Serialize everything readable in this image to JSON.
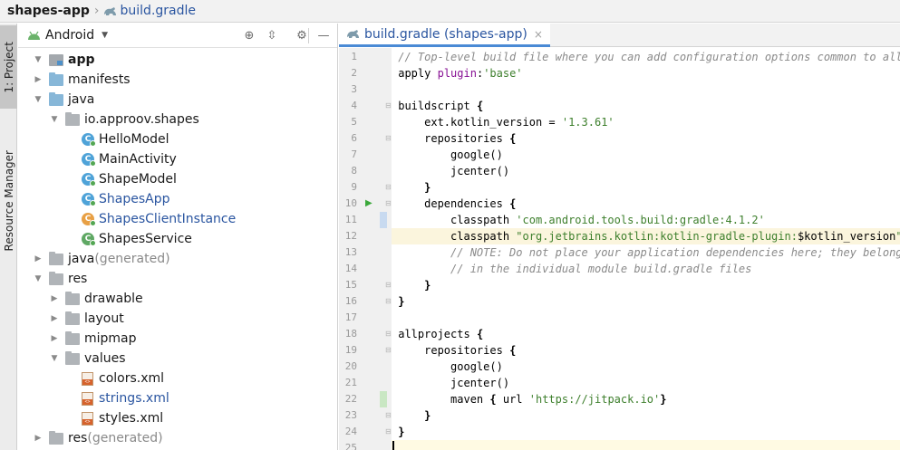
{
  "breadcrumb": {
    "project": "shapes-app",
    "file": "build.gradle"
  },
  "stripe": {
    "project_tab": "1: Project",
    "resource_tab": "Resource Manager"
  },
  "project_panel": {
    "view_label": "Android",
    "tree": [
      {
        "label": "app",
        "bold": true
      },
      {
        "label": "manifests"
      },
      {
        "label": "java"
      },
      {
        "label": "io.approov.shapes"
      },
      {
        "label": "HelloModel"
      },
      {
        "label": "MainActivity"
      },
      {
        "label": "ShapeModel"
      },
      {
        "label": "ShapesApp"
      },
      {
        "label": "ShapesClientInstance"
      },
      {
        "label": "ShapesService"
      },
      {
        "label": "java",
        "suffix": "(generated)"
      },
      {
        "label": "res"
      },
      {
        "label": "drawable"
      },
      {
        "label": "layout"
      },
      {
        "label": "mipmap"
      },
      {
        "label": "values"
      },
      {
        "label": "colors.xml"
      },
      {
        "label": "strings.xml"
      },
      {
        "label": "styles.xml"
      },
      {
        "label": "res",
        "suffix": "(generated)"
      }
    ]
  },
  "editor": {
    "tab_label": "build.gradle (shapes-app)",
    "close_glyph": "×",
    "lines": [
      {
        "n": "1",
        "parts": [
          [
            "c",
            "// Top-level build file where you can add configuration options common to all sub-projects/modules."
          ]
        ]
      },
      {
        "n": "2",
        "parts": [
          [
            "t",
            "apply "
          ],
          [
            "p",
            "plugin"
          ],
          [
            "t",
            ":"
          ],
          [
            "s",
            "'base'"
          ]
        ]
      },
      {
        "n": "3",
        "parts": []
      },
      {
        "n": "4",
        "parts": [
          [
            "t",
            "buildscript "
          ],
          [
            "k",
            "{"
          ]
        ]
      },
      {
        "n": "5",
        "parts": [
          [
            "t",
            "    ext.kotlin_version = "
          ],
          [
            "s",
            "'1.3.61'"
          ]
        ]
      },
      {
        "n": "6",
        "parts": [
          [
            "t",
            "    repositories "
          ],
          [
            "k",
            "{"
          ]
        ]
      },
      {
        "n": "7",
        "parts": [
          [
            "t",
            "        google()"
          ]
        ]
      },
      {
        "n": "8",
        "parts": [
          [
            "t",
            "        jcenter()"
          ]
        ]
      },
      {
        "n": "9",
        "parts": [
          [
            "t",
            "    "
          ],
          [
            "k",
            "}"
          ]
        ]
      },
      {
        "n": "10",
        "parts": [
          [
            "t",
            "    dependencies "
          ],
          [
            "k",
            "{"
          ]
        ]
      },
      {
        "n": "11",
        "parts": [
          [
            "t",
            "        classpath "
          ],
          [
            "s",
            "'com.android.tools.build:gradle:4.1.2'"
          ]
        ]
      },
      {
        "n": "12",
        "parts": [
          [
            "t",
            "        classpath "
          ],
          [
            "s",
            "\"org.jetbrains.kotlin:kotlin-gradle-plugin:"
          ],
          [
            "t",
            "$kotlin_version"
          ],
          [
            "s",
            "\""
          ]
        ]
      },
      {
        "n": "13",
        "parts": [
          [
            "c",
            "        // NOTE: Do not place your application dependencies here; they belong"
          ]
        ]
      },
      {
        "n": "14",
        "parts": [
          [
            "c",
            "        // in the individual module build.gradle files"
          ]
        ]
      },
      {
        "n": "15",
        "parts": [
          [
            "t",
            "    "
          ],
          [
            "k",
            "}"
          ]
        ]
      },
      {
        "n": "16",
        "parts": [
          [
            "k",
            "}"
          ]
        ]
      },
      {
        "n": "17",
        "parts": []
      },
      {
        "n": "18",
        "parts": [
          [
            "t",
            "allprojects "
          ],
          [
            "k",
            "{"
          ]
        ]
      },
      {
        "n": "19",
        "parts": [
          [
            "t",
            "    repositories "
          ],
          [
            "k",
            "{"
          ]
        ]
      },
      {
        "n": "20",
        "parts": [
          [
            "t",
            "        google()"
          ]
        ]
      },
      {
        "n": "21",
        "parts": [
          [
            "t",
            "        jcenter()"
          ]
        ]
      },
      {
        "n": "22",
        "parts": [
          [
            "t",
            "        maven "
          ],
          [
            "k",
            "{"
          ],
          [
            "t",
            " url "
          ],
          [
            "s",
            "'https://jitpack.io'"
          ],
          [
            "k",
            "}"
          ]
        ]
      },
      {
        "n": "23",
        "parts": [
          [
            "t",
            "    "
          ],
          [
            "k",
            "}"
          ]
        ]
      },
      {
        "n": "24",
        "parts": [
          [
            "k",
            "}"
          ]
        ]
      },
      {
        "n": "25",
        "parts": []
      }
    ]
  }
}
